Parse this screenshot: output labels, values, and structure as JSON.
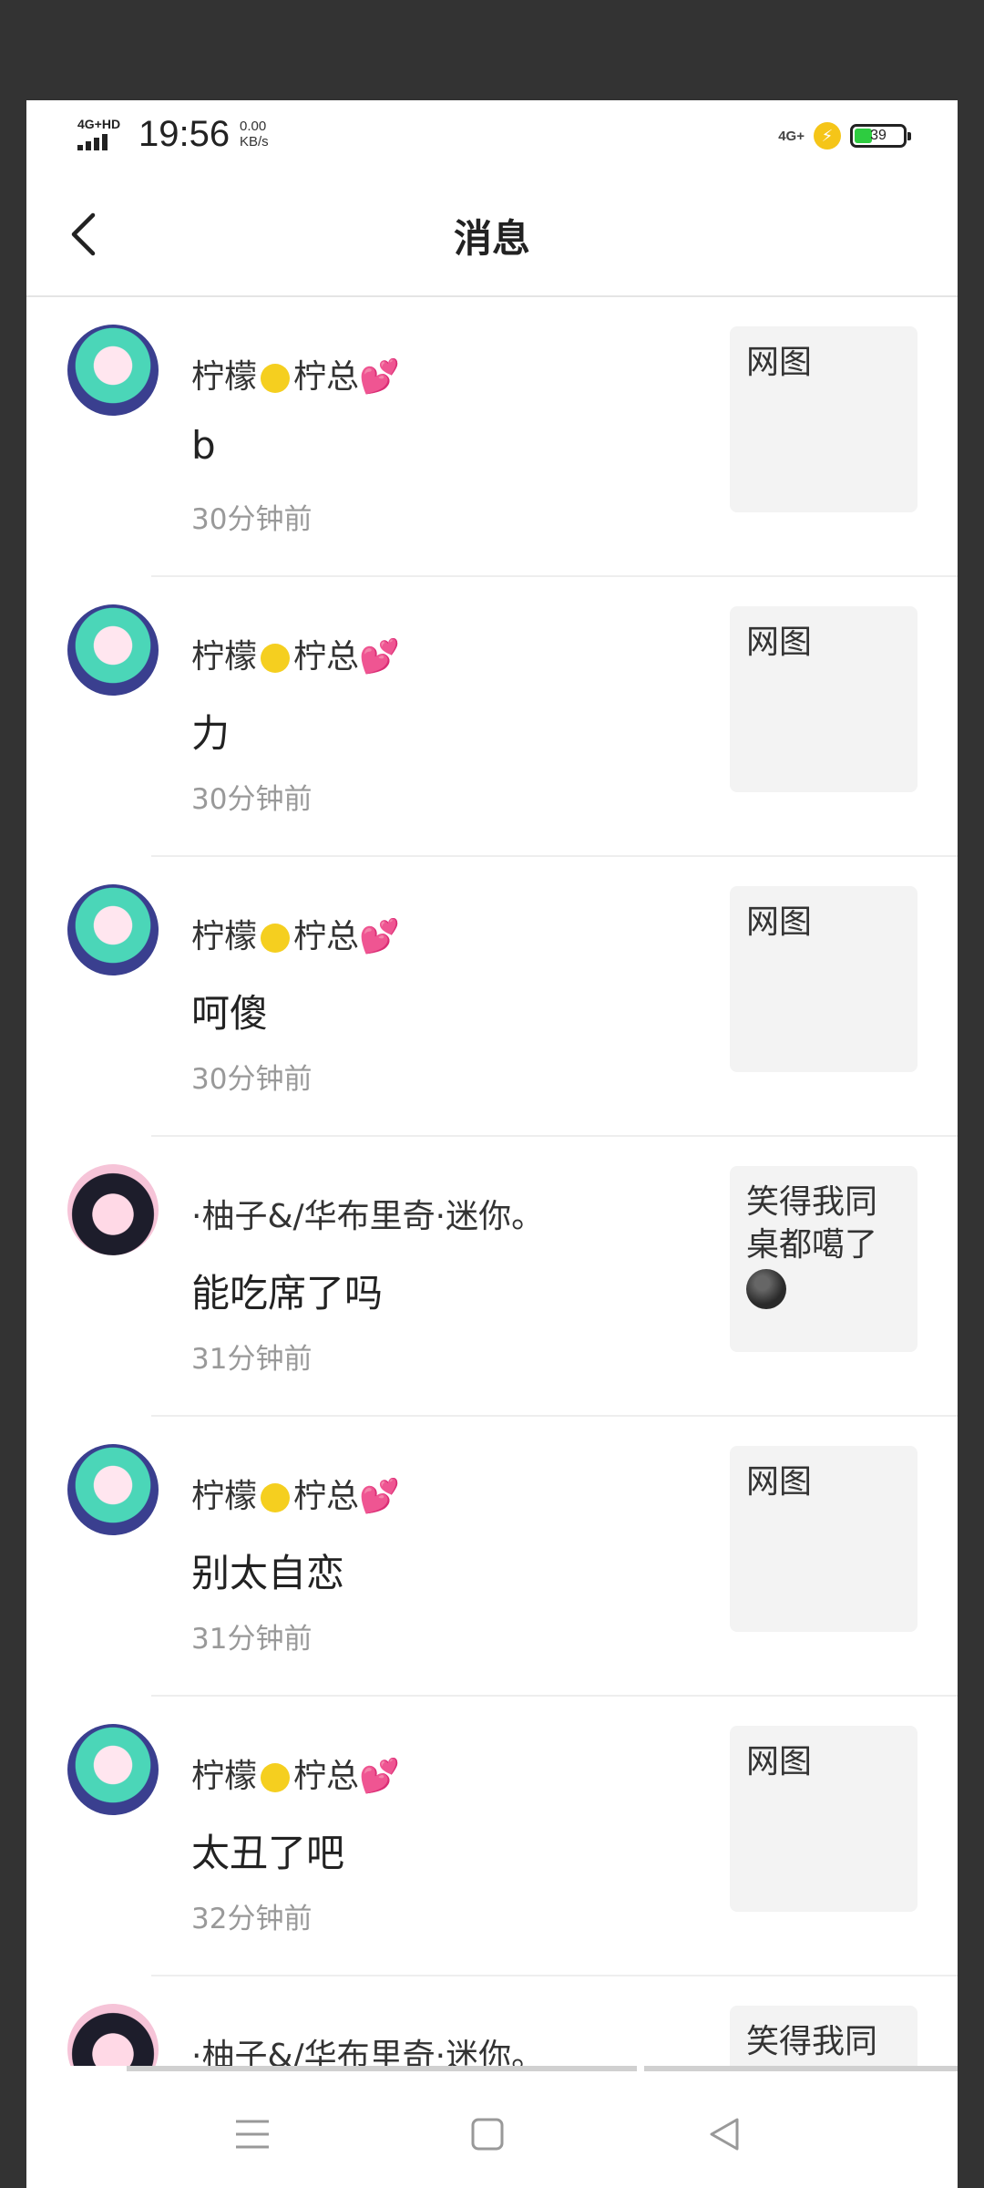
{
  "status_bar": {
    "network_label": "4G+HD",
    "time": "19:56",
    "speed_value": "0.00",
    "speed_unit": "KB/s",
    "network_right": "4G+",
    "battery": "39"
  },
  "header": {
    "title": "消息"
  },
  "messages": [
    {
      "avatar": "avatar-lemon",
      "name_a": "柠檬",
      "name_b": "柠总",
      "text": "b",
      "time": "30分钟前",
      "thumb": "网图"
    },
    {
      "avatar": "avatar-lemon",
      "name_a": "柠檬",
      "name_b": "柠总",
      "text": "力",
      "time": "30分钟前",
      "thumb": "网图"
    },
    {
      "avatar": "avatar-lemon",
      "name_a": "柠檬",
      "name_b": "柠总",
      "text": "呵傻",
      "time": "30分钟前",
      "thumb": "网图"
    },
    {
      "avatar": "avatar-yuzu",
      "name": "·柚子&/华布里奇·迷你。",
      "text": "能吃席了吗",
      "time": "31分钟前",
      "thumb": "笑得我同桌都噶了"
    },
    {
      "avatar": "avatar-lemon",
      "name_a": "柠檬",
      "name_b": "柠总",
      "text": "别太自恋",
      "time": "31分钟前",
      "thumb": "网图"
    },
    {
      "avatar": "avatar-lemon",
      "name_a": "柠檬",
      "name_b": "柠总",
      "text": "太丑了吧",
      "time": "32分钟前",
      "thumb": "网图"
    },
    {
      "avatar": "avatar-yuzu",
      "name": "·柚子&/华布里奇·迷你。",
      "text": "",
      "time": "",
      "thumb": "笑得我同"
    }
  ],
  "colors": {
    "accent_heart": "#e8233f",
    "lemon": "#f5cf1f",
    "battery_fill": "#2ecc40"
  },
  "icons": [
    "back-arrow-icon",
    "menu-icon",
    "home-icon",
    "back-triangle-icon",
    "lemon-emoji-icon",
    "hearts-emoji-icon",
    "smirk-emoji-icon"
  ]
}
